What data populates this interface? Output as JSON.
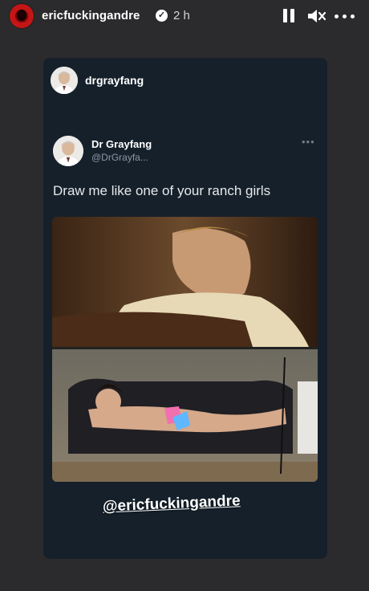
{
  "story": {
    "username": "ericfuckingandre",
    "time_ago": "2 h",
    "controls": [
      "pause-icon",
      "mute-icon",
      "more-icon"
    ],
    "background_color": "#2b2b2d"
  },
  "shared_post": {
    "account": "drgrayfang",
    "tweet": {
      "display_name": "Dr Grayfang",
      "handle": "@DrGrayfa...",
      "text": "Draw me like one of your ranch girls",
      "card_color": "#15202b"
    }
  },
  "sticker": {
    "mention": "@ericfuckingandre"
  }
}
